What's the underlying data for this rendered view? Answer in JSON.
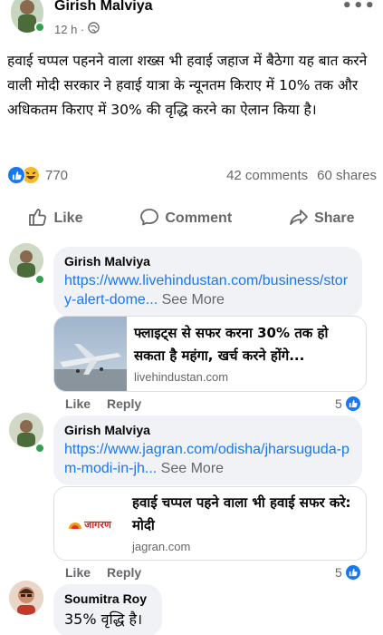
{
  "post": {
    "author": "Girish Malviya",
    "time": "12 h ·",
    "text": "हवाई चप्पल पहनने वाला शख्स भी हवाई जहाज में बैठेगा यह बात करने वाली मोदी सरकार ने हवाई यात्रा के न्यूनतम किराए में 10% तक और अधिकतम किराए में 30% की वृद्धि करने का ऐलान किया है।",
    "reaction_count": "770",
    "comments_count": "42 comments",
    "shares_count": "60 shares"
  },
  "actions": {
    "like": "Like",
    "comment": "Comment",
    "share": "Share"
  },
  "comments": [
    {
      "author": "Girish Malviya",
      "link": "https://www.livehindustan.com/business/story-alert-dome...",
      "see_more": " See More",
      "preview_title": "फ्लाइट्स से सफर करना 30% तक हो सकता है महंगा, खर्च करने होंगे...",
      "preview_domain": "livehindustan.com",
      "like_label": "Like",
      "reply_label": "Reply",
      "likes": "5"
    },
    {
      "author": "Girish Malviya",
      "link": "https://www.jagran.com/odisha/jharsuguda-pm-modi-in-jh...",
      "see_more": " See More",
      "preview_logo": "जागरण",
      "preview_title": "हवाई चप्पल पहने वाला भी हवाई सफर करे: मोदी",
      "preview_domain": "jagran.com",
      "like_label": "Like",
      "reply_label": "Reply",
      "likes": "5"
    },
    {
      "author": "Soumitra Roy",
      "text": "35% वृद्धि है।"
    }
  ],
  "colors": {
    "facebook_blue": "#1877f2",
    "bubble_bg": "#f0f2f5",
    "secondary_text": "#65676b",
    "online_green": "#31a24c"
  },
  "icons": [
    "globe-icon",
    "more-icon",
    "like-reaction-icon",
    "haha-reaction-icon",
    "thumbs-up-icon",
    "comment-icon",
    "share-icon",
    "online-status-icon"
  ]
}
